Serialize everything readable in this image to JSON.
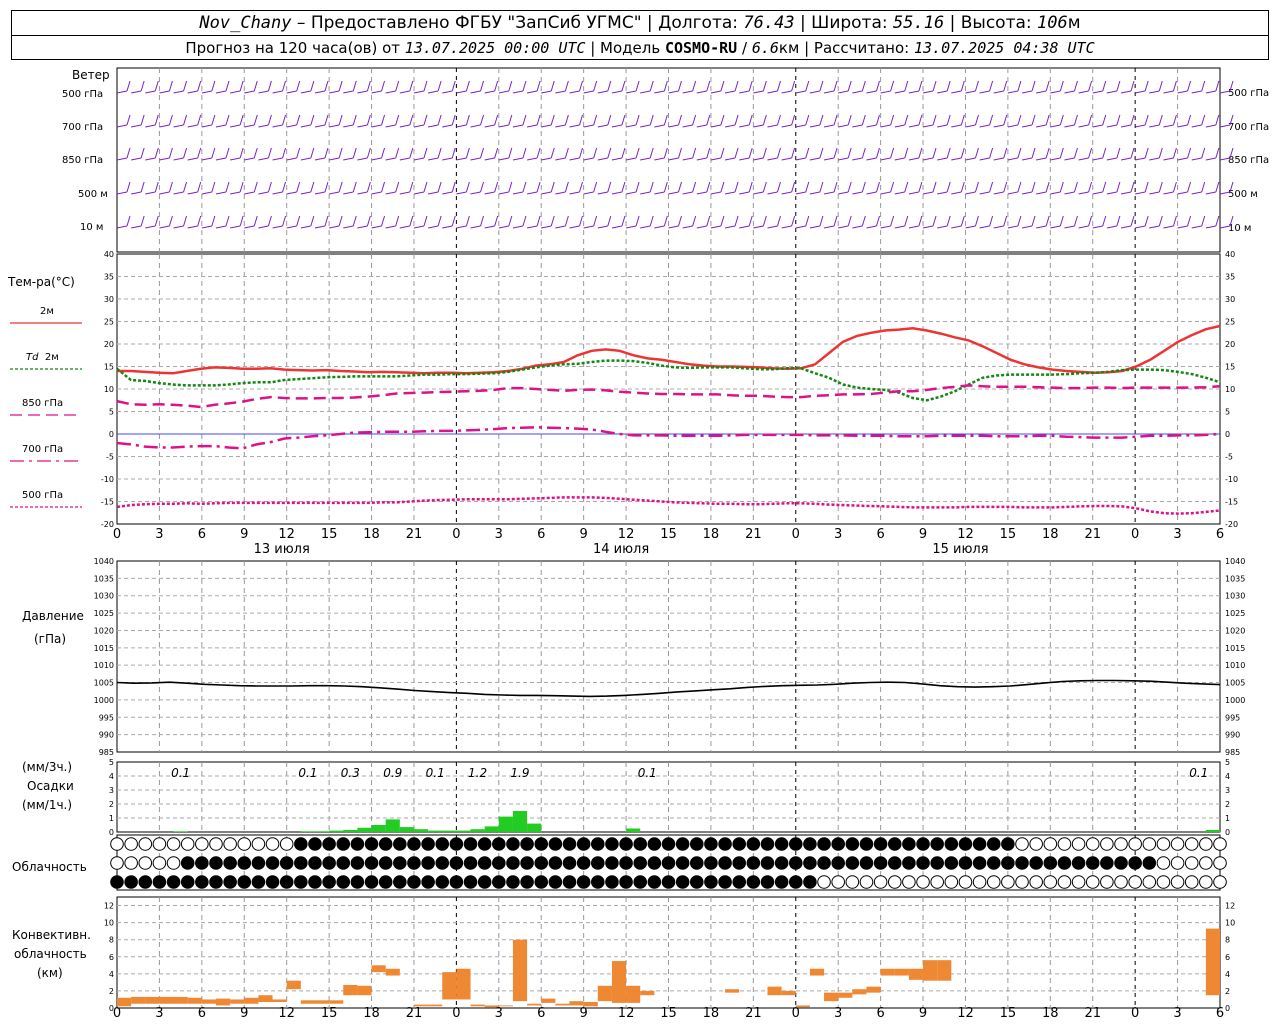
{
  "header": {
    "station": "Nov_Chany",
    "provider": "Предоставлено ФГБУ \"ЗапСиб УГМС\"",
    "lon_label": "Долгота:",
    "lon": "76.43",
    "lat_label": "Широта:",
    "lat": "55.16",
    "alt_label": "Высота:",
    "alt": "106",
    "alt_unit": "м",
    "forecast_prefix": "Прогноз на 120 часа(ов) от",
    "forecast_time": "13.07.2025 00:00 UTC",
    "model_label": "Модель",
    "model": "COSMO-RU",
    "resolution": "6.6",
    "res_unit": "км",
    "calc_label": "Рассчитано:",
    "calc_time": "13.07.2025 04:38 UTC"
  },
  "labels": {
    "wind": "Ветер",
    "wind_levels": [
      "500 гПа",
      "700 гПа",
      "850 гПа",
      "500 м",
      "10  м"
    ],
    "temp_title": "Тем-ра(°C)",
    "t2m": "2м",
    "td_prefix": "Td",
    "td": "2м",
    "t850": "850 гПа",
    "t700": "700 гПа",
    "t500": "500 гПа",
    "pressure_title": "Давление",
    "pressure_unit": "(гПа)",
    "precip_unit3": "(мм/3ч.)",
    "precip_title": "Осадки",
    "precip_unit1": "(мм/1ч.)",
    "cloud_title": "Облачность",
    "conv_title1": "Конвективн.",
    "conv_title2": "облачность",
    "conv_unit": "(км)"
  },
  "colors": {
    "t2m": "#ee3333",
    "td": "#118811",
    "level": "#dd1188",
    "wind": "#7722cc",
    "precip": "#22cc22",
    "conv": "#ee8833",
    "pressure": "#000000"
  },
  "chart_data": {
    "type": "line",
    "x_hours_label": [
      "0",
      "3",
      "6",
      "9",
      "12",
      "15",
      "18",
      "21",
      "0",
      "3",
      "6",
      "9",
      "12",
      "15",
      "18",
      "21",
      "0",
      "3",
      "6",
      "9",
      "12",
      "15",
      "18",
      "21",
      "0",
      "3",
      "6"
    ],
    "days": [
      "13 июля",
      "14 июля",
      "15 июля"
    ],
    "temp_axis": {
      "ylim": [
        -20,
        40
      ],
      "ticks": [
        -20,
        -15,
        -10,
        -5,
        0,
        5,
        10,
        15,
        20,
        25,
        30,
        35,
        40
      ]
    },
    "series": [
      {
        "key": "t2m",
        "values": [
          14,
          14,
          13.8,
          13.6,
          13.5,
          14,
          14.5,
          14.8,
          14.7,
          14.5,
          14.5,
          14.6,
          14.3,
          14.2,
          14.1,
          14.2,
          14.0,
          13.9,
          13.7,
          13.8,
          13.7,
          13.6,
          13.5,
          13.6,
          13.6,
          13.5,
          13.6,
          13.7,
          14.0,
          14.5,
          15.2,
          15.5,
          16.0,
          17.5,
          18.5,
          18.8,
          18.5,
          17.5,
          16.8,
          16.5,
          16.0,
          15.5,
          15.2,
          15.0,
          15.0,
          14.9,
          14.8,
          14.6,
          14.5,
          14.6,
          15.5,
          18.0,
          20.5,
          21.8,
          22.5,
          23.0,
          23.2,
          23.5,
          23.0,
          22.3,
          21.5,
          20.8,
          19.5,
          18.0,
          16.5,
          15.5,
          14.8,
          14.3,
          14.0,
          13.8,
          13.6,
          13.7,
          14.0,
          15.0,
          16.5,
          18.5,
          20.5,
          22.0,
          23.3,
          24.0
        ]
      },
      {
        "key": "td",
        "values": [
          14.5,
          12,
          11.8,
          11.3,
          11,
          10.8,
          10.8,
          10.8,
          11,
          11.3,
          11.5,
          11.5,
          12,
          12.2,
          12.4,
          12.6,
          12.7,
          12.8,
          12.8,
          12.8,
          12.8,
          13,
          13.2,
          13.2,
          13.3,
          13.3,
          13.4,
          13.5,
          13.8,
          14.3,
          14.8,
          15.2,
          15.5,
          15.6,
          16,
          16.3,
          16.3,
          16.2,
          15.8,
          15.2,
          14.8,
          14.7,
          14.8,
          14.8,
          14.8,
          14.6,
          14.4,
          14.4,
          14.6,
          14.6,
          13.5,
          12.5,
          11,
          10.3,
          10,
          9.8,
          9.2,
          8,
          7.5,
          8.3,
          9.5,
          11,
          12.5,
          13,
          13.2,
          13.2,
          13.2,
          13.2,
          13.3,
          13.5,
          13.6,
          13.8,
          14.2,
          14.3,
          14.3,
          14.2,
          13.8,
          13.3,
          12.5,
          11.5
        ]
      },
      {
        "key": "t850",
        "values": [
          7.3,
          6.6,
          6.5,
          6.6,
          6.5,
          6.3,
          6.0,
          6.5,
          6.8,
          7.2,
          7.8,
          8.2,
          8.0,
          7.9,
          7.9,
          8.0,
          8.0,
          8.1,
          8.3,
          8.6,
          9.0,
          9.1,
          9.2,
          9.3,
          9.4,
          9.5,
          9.6,
          9.8,
          10.2,
          10.2,
          10.0,
          9.8,
          9.6,
          9.8,
          9.9,
          9.7,
          9.4,
          9.2,
          9.0,
          8.9,
          8.9,
          8.8,
          8.8,
          8.8,
          8.6,
          8.5,
          8.5,
          8.3,
          8.2,
          8.2,
          8.5,
          8.6,
          8.8,
          8.8,
          8.9,
          9.2,
          9.5,
          9.5,
          9.8,
          10.2,
          10.5,
          10.8,
          10.6,
          10.5,
          10.5,
          10.5,
          10.4,
          10.3,
          10.2,
          10.2,
          10.3,
          10.3,
          10.2,
          10.3,
          10.3,
          10.3,
          10.3,
          10.3,
          10.4,
          10.6
        ]
      },
      {
        "key": "t700",
        "values": [
          -2,
          -2.3,
          -2.8,
          -3,
          -3,
          -2.8,
          -2.7,
          -2.7,
          -3,
          -3.2,
          -2.3,
          -1.8,
          -1,
          -0.8,
          -0.5,
          -0.3,
          0,
          0.3,
          0.4,
          0.5,
          0.5,
          0.5,
          0.6,
          0.7,
          0.7,
          0.8,
          0.9,
          1.1,
          1.3,
          1.4,
          1.5,
          1.4,
          1.3,
          1.2,
          1.0,
          0.5,
          0.0,
          -0.3,
          -0.3,
          -0.3,
          -0.4,
          -0.4,
          -0.4,
          -0.4,
          -0.3,
          -0.2,
          -0.2,
          -0.2,
          -0.2,
          -0.2,
          -0.3,
          -0.3,
          -0.3,
          -0.4,
          -0.4,
          -0.4,
          -0.5,
          -0.5,
          -0.5,
          -0.4,
          -0.4,
          -0.4,
          -0.4,
          -0.5,
          -0.5,
          -0.5,
          -0.4,
          -0.4,
          -0.6,
          -0.7,
          -0.8,
          -0.8,
          -0.8,
          -0.6,
          -0.4,
          -0.4,
          -0.3,
          -0.3,
          -0.2,
          0.0
        ]
      },
      {
        "key": "t500",
        "values": [
          -16.2,
          -15.8,
          -15.6,
          -15.5,
          -15.5,
          -15.4,
          -15.5,
          -15.4,
          -15.3,
          -15.3,
          -15.3,
          -15.3,
          -15.3,
          -15.3,
          -15.3,
          -15.3,
          -15.3,
          -15.3,
          -15.3,
          -15.2,
          -15.2,
          -15.0,
          -14.8,
          -14.7,
          -14.6,
          -14.5,
          -14.5,
          -14.5,
          -14.5,
          -14.4,
          -14.3,
          -14.2,
          -14.1,
          -14.1,
          -14.1,
          -14.2,
          -14.4,
          -14.6,
          -14.8,
          -15.0,
          -15.2,
          -15.3,
          -15.4,
          -15.5,
          -15.5,
          -15.6,
          -15.6,
          -15.5,
          -15.4,
          -15.4,
          -15.5,
          -15.7,
          -15.8,
          -15.9,
          -16.0,
          -16.1,
          -16.2,
          -16.3,
          -16.3,
          -16.3,
          -16.3,
          -16.2,
          -16.2,
          -16.2,
          -16.2,
          -16.3,
          -16.3,
          -16.3,
          -16.2,
          -16.1,
          -16.0,
          -16.0,
          -16.1,
          -16.5,
          -17.2,
          -17.6,
          -17.7,
          -17.6,
          -17.3,
          -17.0
        ]
      }
    ],
    "pressure_axis": {
      "ylim": [
        985,
        1040
      ],
      "ticks": [
        985,
        990,
        995,
        1000,
        1005,
        1010,
        1015,
        1020,
        1025,
        1030,
        1035,
        1040
      ]
    },
    "pressure": [
      1005.0,
      1004.8,
      1004.9,
      1005.1,
      1004.8,
      1004.5,
      1004.3,
      1004.1,
      1004.0,
      1004.0,
      1004.0,
      1004.1,
      1004.1,
      1004.0,
      1003.8,
      1003.5,
      1003.1,
      1002.7,
      1002.4,
      1002.1,
      1001.9,
      1001.6,
      1001.4,
      1001.3,
      1001.3,
      1001.2,
      1001.1,
      1001.0,
      1001.1,
      1001.3,
      1001.6,
      1001.9,
      1002.3,
      1002.6,
      1002.9,
      1003.2,
      1003.6,
      1003.9,
      1004.1,
      1004.2,
      1004.3,
      1004.5,
      1004.8,
      1005.0,
      1005.1,
      1005.0,
      1004.6,
      1004.1,
      1003.8,
      1003.7,
      1003.8,
      1004.0,
      1004.4,
      1004.9,
      1005.3,
      1005.5,
      1005.6,
      1005.6,
      1005.5,
      1005.4,
      1005.1,
      1004.8,
      1004.6,
      1004.4
    ],
    "precip_axis": {
      "ylim": [
        0,
        5
      ],
      "ticks": [
        0,
        1,
        2,
        3,
        4,
        5
      ]
    },
    "precip_3h_labels": [
      {
        "hour": 4.5,
        "text": "0.1"
      },
      {
        "hour": 13.5,
        "text": "0.1"
      },
      {
        "hour": 16.5,
        "text": "0.3"
      },
      {
        "hour": 19.5,
        "text": "0.9"
      },
      {
        "hour": 22.5,
        "text": "0.1"
      },
      {
        "hour": 25.5,
        "text": "1.2"
      },
      {
        "hour": 28.5,
        "text": "1.9"
      },
      {
        "hour": 37.5,
        "text": "0.1"
      },
      {
        "hour": 76.5,
        "text": "0.1"
      }
    ],
    "precip_1h": [
      {
        "hour": 4,
        "v": 0.05
      },
      {
        "hour": 13,
        "v": 0.05
      },
      {
        "hour": 14,
        "v": 0.05
      },
      {
        "hour": 15,
        "v": 0.1
      },
      {
        "hour": 16,
        "v": 0.15
      },
      {
        "hour": 17,
        "v": 0.3
      },
      {
        "hour": 18,
        "v": 0.5
      },
      {
        "hour": 19,
        "v": 0.9
      },
      {
        "hour": 20,
        "v": 0.35
      },
      {
        "hour": 21,
        "v": 0.2
      },
      {
        "hour": 22,
        "v": 0.1
      },
      {
        "hour": 23,
        "v": 0.1
      },
      {
        "hour": 24,
        "v": 0.1
      },
      {
        "hour": 25,
        "v": 0.2
      },
      {
        "hour": 26,
        "v": 0.4
      },
      {
        "hour": 27,
        "v": 1.1
      },
      {
        "hour": 28,
        "v": 1.5
      },
      {
        "hour": 29,
        "v": 0.6
      },
      {
        "hour": 36,
        "v": 0.25
      },
      {
        "hour": 77,
        "v": 0.15
      }
    ],
    "conv_axis": {
      "ylim": [
        0,
        13
      ],
      "ticks": [
        0,
        2,
        4,
        6,
        8,
        10,
        12
      ]
    },
    "conv": [
      {
        "hour": 0,
        "b": 0.2,
        "t": 1.2
      },
      {
        "hour": 1,
        "b": 0.5,
        "t": 1.3
      },
      {
        "hour": 2,
        "b": 0.5,
        "t": 1.3
      },
      {
        "hour": 3,
        "b": 0.5,
        "t": 1.3
      },
      {
        "hour": 4,
        "b": 0.5,
        "t": 1.3
      },
      {
        "hour": 5,
        "b": 0.5,
        "t": 1.2
      },
      {
        "hour": 6,
        "b": 0.5,
        "t": 1.0
      },
      {
        "hour": 7,
        "b": 0.3,
        "t": 1.1
      },
      {
        "hour": 8,
        "b": 0.5,
        "t": 1.0
      },
      {
        "hour": 9,
        "b": 0.5,
        "t": 1.2
      },
      {
        "hour": 10,
        "b": 0.7,
        "t": 1.5
      },
      {
        "hour": 11,
        "b": 0.7,
        "t": 1.0
      },
      {
        "hour": 12,
        "b": 2.2,
        "t": 3.2
      },
      {
        "hour": 13,
        "b": 0.5,
        "t": 0.9
      },
      {
        "hour": 14,
        "b": 0.5,
        "t": 0.9
      },
      {
        "hour": 15,
        "b": 0.5,
        "t": 0.9
      },
      {
        "hour": 16,
        "b": 1.5,
        "t": 2.7
      },
      {
        "hour": 17,
        "b": 1.5,
        "t": 2.6
      },
      {
        "hour": 18,
        "b": 4.2,
        "t": 5.0
      },
      {
        "hour": 19,
        "b": 3.8,
        "t": 4.6
      },
      {
        "hour": 21,
        "b": 0.2,
        "t": 0.4
      },
      {
        "hour": 22,
        "b": 0.2,
        "t": 0.4
      },
      {
        "hour": 23,
        "b": 1.0,
        "t": 4.2
      },
      {
        "hour": 24,
        "b": 1.0,
        "t": 4.6
      },
      {
        "hour": 25,
        "b": 0.2,
        "t": 0.4
      },
      {
        "hour": 26,
        "b": 0.1,
        "t": 0.3
      },
      {
        "hour": 27,
        "b": 0.2,
        "t": 0.3
      },
      {
        "hour": 28,
        "b": 0.8,
        "t": 8.0
      },
      {
        "hour": 29,
        "b": 0.3,
        "t": 0.5
      },
      {
        "hour": 30,
        "b": 0.6,
        "t": 1.1
      },
      {
        "hour": 31,
        "b": 0.3,
        "t": 0.5
      },
      {
        "hour": 32,
        "b": 0.3,
        "t": 0.8
      },
      {
        "hour": 33,
        "b": 0.2,
        "t": 0.7
      },
      {
        "hour": 34,
        "b": 0.8,
        "t": 2.6
      },
      {
        "hour": 35,
        "b": 0.6,
        "t": 5.5
      },
      {
        "hour": 36,
        "b": 0.6,
        "t": 2.6
      },
      {
        "hour": 37,
        "b": 1.5,
        "t": 2.0
      },
      {
        "hour": 43,
        "b": 1.8,
        "t": 2.2
      },
      {
        "hour": 46,
        "b": 1.5,
        "t": 2.5
      },
      {
        "hour": 47,
        "b": 1.5,
        "t": 2.0
      },
      {
        "hour": 48,
        "b": 0.1,
        "t": 0.3
      },
      {
        "hour": 49,
        "b": 3.8,
        "t": 4.6
      },
      {
        "hour": 50,
        "b": 0.8,
        "t": 1.8
      },
      {
        "hour": 51,
        "b": 1.2,
        "t": 1.8
      },
      {
        "hour": 52,
        "b": 1.6,
        "t": 2.2
      },
      {
        "hour": 53,
        "b": 1.8,
        "t": 2.5
      },
      {
        "hour": 54,
        "b": 3.8,
        "t": 4.6
      },
      {
        "hour": 55,
        "b": 3.8,
        "t": 4.6
      },
      {
        "hour": 56,
        "b": 3.3,
        "t": 4.6
      },
      {
        "hour": 57,
        "b": 3.2,
        "t": 5.6
      },
      {
        "hour": 58,
        "b": 3.2,
        "t": 5.6
      },
      {
        "hour": 77,
        "b": 1.5,
        "t": 9.3
      }
    ]
  }
}
